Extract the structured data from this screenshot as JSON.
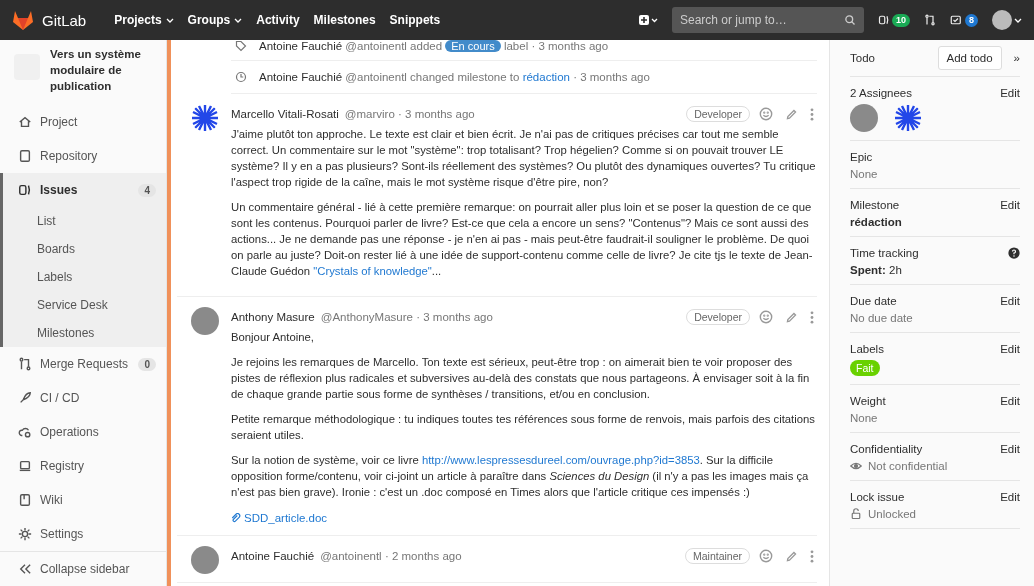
{
  "topbar": {
    "brand": "GitLab",
    "nav": [
      {
        "label": "Projects",
        "dropdown": true
      },
      {
        "label": "Groups",
        "dropdown": true
      },
      {
        "label": "Activity",
        "dropdown": false
      },
      {
        "label": "Milestones",
        "dropdown": false
      },
      {
        "label": "Snippets",
        "dropdown": false
      }
    ],
    "search": {
      "placeholder": "Search or jump to…"
    },
    "issues_count": "10",
    "todos_count": "8"
  },
  "sidebar": {
    "project": "Vers un système modulaire de publication",
    "items": [
      {
        "label": "Project",
        "selected": false
      },
      {
        "label": "Repository",
        "selected": false
      },
      {
        "label": "Issues",
        "count": "4",
        "selected": true,
        "children": [
          {
            "label": "List"
          },
          {
            "label": "Boards"
          },
          {
            "label": "Labels"
          },
          {
            "label": "Service Desk"
          },
          {
            "label": "Milestones"
          }
        ]
      },
      {
        "label": "Merge Requests",
        "count": "0",
        "selected": false
      },
      {
        "label": "CI / CD",
        "selected": false
      },
      {
        "label": "Operations",
        "selected": false
      },
      {
        "label": "Registry",
        "selected": false
      },
      {
        "label": "Wiki",
        "selected": false
      },
      {
        "label": "Settings",
        "selected": false
      }
    ],
    "collapse": "Collapse sidebar"
  },
  "timeline": [
    {
      "kind": "label_note",
      "author": "Antoine Fauchié",
      "handle": "@antoinentl",
      "action": "added",
      "label": "En cours",
      "after": "label",
      "time": "· 3 months ago"
    },
    {
      "kind": "milestone_note",
      "author": "Antoine Fauchié",
      "handle": "@antoinentl",
      "action": "changed milestone to",
      "link": "rédaction",
      "time": "· 3 months ago"
    },
    {
      "kind": "comment",
      "avatar": {
        "kind": "pattern"
      },
      "author": "Marcello Vitali-Rosati",
      "handle": "@marviro",
      "time": "· 3 months ago",
      "role": "Developer",
      "paragraphs": [
        [
          {
            "text": "J'aime plutôt ton approche. Le texte est clair et bien écrit. Je n'ai pas de critiques précises car tout me semble correct. Un commentaire sur le mot \"système\": trop totalisant? Trop hégelien? Comme si on pouvait trouver LE système? Il y en a pas plusieurs? Sont-ils réellement des systèmes? Ou plutôt des dynamiques ouvertes? Tu critique l'aspect trop rigide de la caîne, mais le mot système risque d'être pire, non?"
          }
        ],
        [
          {
            "text": "Un commentaire général - lié à cette première remarque: on pourrait aller plus loin et se poser la question de ce que sont les contenus. Pourquoi parler de livre? Est-ce que cela a encore un sens? \"Contenus\"? Mais ce sont aussi des actions... Je ne demande pas une réponse - je n'en ai pas - mais peut-être faudrait-il souligner le problème. De quoi on parle au juste? Doit-on rester lié à une idée de support-contenu comme celle de livre? Je cite tjs le texte de Jean-Claude Guédon "
          },
          {
            "link": "\"Crystals of knowledge\""
          },
          {
            "text": "..."
          }
        ]
      ]
    },
    {
      "kind": "comment",
      "avatar": {
        "kind": "photo"
      },
      "author": "Anthony Masure",
      "handle": "@AnthonyMasure",
      "time": "· 3 months ago",
      "role": "Developer",
      "paragraphs": [
        [
          {
            "text": "Bonjour Antoine,"
          }
        ],
        [
          {
            "text": "Je rejoins les remarques de Marcello. Ton texte est sérieux, peut-être trop : on aimerait bien te voir proposer des pistes de réflexion plus radicales et subversives au-delà des constats que nous partageons. À envisager soit à la fin de chaque grande partie sous forme de synthèses / transitions, et/ou en conclusion."
          }
        ],
        [
          {
            "text": "Petite remarque méthodologique : tu indiques toutes tes références sous forme de renvois, mais parfois des citations seraient utiles."
          }
        ],
        [
          {
            "text": "Sur la notion de système, voir ce livre "
          },
          {
            "link": "http://www.lespressesdureel.com/ouvrage.php?id=3853"
          },
          {
            "text": ". Sur la difficile opposition forme/contenu, voir ci-joint un article à paraître dans *Sciences du Design* (il n'y a pas les images mais ça n'est pas bien grave). Ironie : c'est un .doc composé en Times alors que l'article critique ces impensés :)"
          }
        ]
      ],
      "attachment": "SDD_article.doc"
    },
    {
      "kind": "comment",
      "avatar": {
        "kind": "photo"
      },
      "author": "Antoine Fauchié",
      "handle": "@antoinentl",
      "time": "· 2 months ago",
      "role": "Maintainer"
    }
  ],
  "right": {
    "todo": "Todo",
    "add_todo": "Add todo",
    "collapse": "»",
    "blocks": [
      {
        "kind": "assignees",
        "title": "2 Assignees",
        "edit": "Edit"
      },
      {
        "kind": "muted",
        "title": "Epic",
        "value": "None"
      },
      {
        "kind": "bold",
        "title": "Milestone",
        "edit": "Edit",
        "value": "rédaction"
      },
      {
        "kind": "time",
        "title": "Time tracking",
        "spent_label": "Spent:",
        "value": "2h"
      },
      {
        "kind": "muted",
        "title": "Due date",
        "edit": "Edit",
        "value": "No due date"
      },
      {
        "kind": "label",
        "title": "Labels",
        "edit": "Edit",
        "value": "Fait",
        "color": "#69d100"
      },
      {
        "kind": "muted",
        "title": "Weight",
        "edit": "Edit",
        "value": "None"
      },
      {
        "kind": "eye",
        "title": "Confidentiality",
        "edit": "Edit",
        "value": "Not confidential"
      },
      {
        "kind": "lock",
        "title": "Lock issue",
        "edit": "Edit",
        "value": "Unlocked"
      }
    ]
  }
}
